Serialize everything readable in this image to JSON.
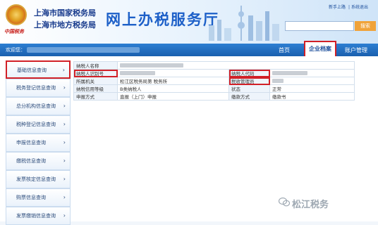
{
  "header": {
    "bureau_line1": "上海市国家税务局",
    "bureau_line2": "上海市地方税务局",
    "title": "网上办税服务厅",
    "emblem_caption": "中国税务",
    "top_links": [
      "新手上路",
      "系统退出"
    ],
    "search_button": "搜索",
    "search_placeholder": ""
  },
  "navbar": {
    "welcome": "欢迎您：",
    "items": [
      "首页",
      "企业档案",
      "账户管理"
    ],
    "active": "企业档案"
  },
  "sidebar": {
    "items": [
      {
        "label": "基础信息查询",
        "active": true
      },
      {
        "label": "税务登记信息查询",
        "active": false
      },
      {
        "label": "总分机构信息查询",
        "active": false
      },
      {
        "label": "税种登记信息查询",
        "active": false
      },
      {
        "label": "申报信息查询",
        "active": false
      },
      {
        "label": "缴税信息查询",
        "active": false
      },
      {
        "label": "发票核定信息查询",
        "active": false
      },
      {
        "label": "购票信息查询",
        "active": false
      },
      {
        "label": "发票缴销信息查询",
        "active": false
      }
    ],
    "arrow": "›"
  },
  "info_table": {
    "rows": [
      {
        "label1": "纳税人名称",
        "value1": "",
        "label2": "",
        "value2": ""
      },
      {
        "label1": "纳税人识别号",
        "value1": "",
        "label2": "纳税人代码",
        "value2": ""
      },
      {
        "label1": "所属机关",
        "value1": "松江区税务局第  税务所",
        "label2": "税收管理员",
        "value2": ""
      },
      {
        "label1": "纳税信用等级",
        "value1": "B类纳税人",
        "label2": "状态",
        "value2": "正常"
      },
      {
        "label1": "申报方式",
        "value1": "直报（上门）申报",
        "label2": "缴款方式",
        "value2": "缴款书"
      }
    ]
  },
  "watermark": "松江税务",
  "colors": {
    "nav_blue": "#1a5fae",
    "highlight_red": "#d12027",
    "title_blue": "#1d60c8",
    "search_orange": "#f0a33a"
  }
}
